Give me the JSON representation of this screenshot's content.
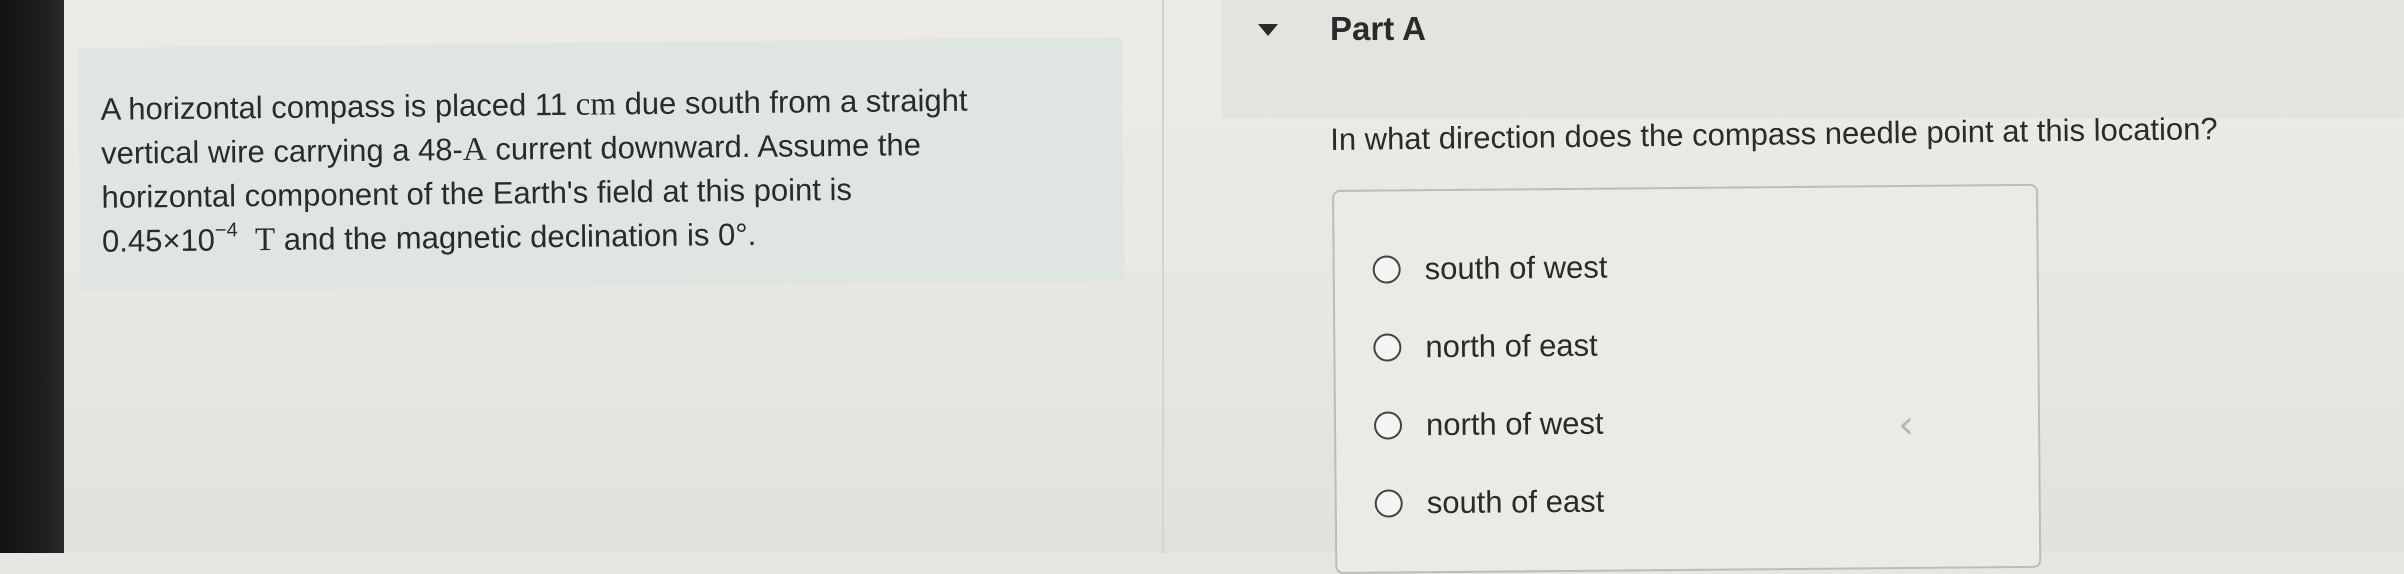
{
  "problem": {
    "line1_a": "A horizontal compass is placed 11 ",
    "line1_unit": "cm",
    "line1_b": " due south from a straight",
    "line2_a": "vertical wire carrying a 48-",
    "line2_unit": "A",
    "line2_b": " current downward. Assume the",
    "line3": "horizontal component of the Earth's field at this point is",
    "line4_coef": "0.45×10",
    "line4_exp": "−4",
    "line4_unit": "T",
    "line4_b": " and the magnetic declination is 0°."
  },
  "part": {
    "title": "Part A",
    "question": "In what direction does the compass needle point at this location?",
    "options": [
      "south of west",
      "north of east",
      "north of west",
      "south of east"
    ]
  }
}
